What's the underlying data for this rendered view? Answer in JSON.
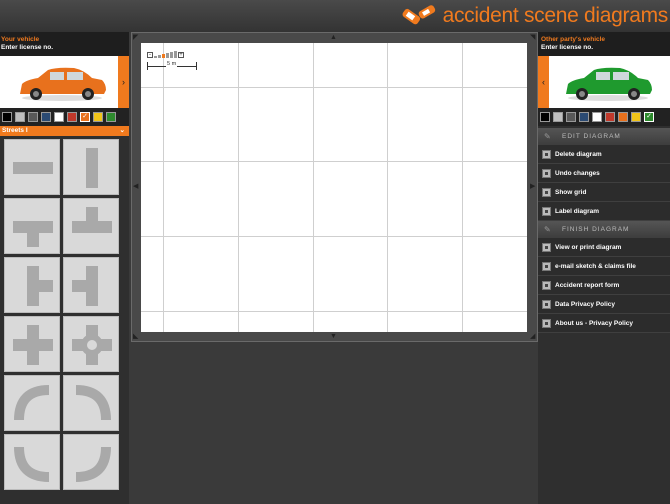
{
  "header": {
    "logo_text": "accident scene diagrams",
    "logo_icon": "crashed-cars-icon"
  },
  "left_panel": {
    "vehicle_title": "Your vehicle",
    "license_prompt": "Enter license no.",
    "vehicle_color": "#e8711d",
    "next_arrow": "›",
    "swatches": [
      "#000000",
      "#bfbfbf",
      "#595959",
      "#2b4a72",
      "#ffffff",
      "#c0392b",
      "#e8711d",
      "#f0c419",
      "#2e8b2e"
    ],
    "selected_swatch_index": 6,
    "streets_label": "Streets I",
    "streets_chevron": "⌄",
    "tiles": [
      "straight-horizontal",
      "straight-vertical",
      "t-junction-down",
      "t-junction-up",
      "t-junction-right",
      "t-junction-left",
      "crossroads",
      "roundabout",
      "curve-top-left",
      "curve-top-right",
      "curve-bottom-left",
      "curve-bottom-right"
    ]
  },
  "canvas": {
    "scale_label": "5 m",
    "zoom_minus": "-",
    "zoom_plus": "+",
    "zoom_level": 2,
    "zoom_levels": 6
  },
  "right_panel": {
    "vehicle_title": "Other party's vehicle",
    "license_prompt": "Enter license no.",
    "vehicle_color": "#1f9a2e",
    "prev_arrow": "‹",
    "swatches": [
      "#000000",
      "#bfbfbf",
      "#595959",
      "#2b4a72",
      "#ffffff",
      "#c0392b",
      "#e8711d",
      "#f0c419",
      "#2e8b2e"
    ],
    "selected_swatch_index": 8,
    "edit_section": "EDIT DIAGRAM",
    "edit_items": [
      "Delete diagram",
      "Undo changes",
      "Show grid",
      "Label diagram"
    ],
    "finish_section": "FINISH DIAGRAM",
    "finish_items": [
      "View or print diagram",
      "e-mail sketch & claims file",
      "Accident report form",
      "Data Privacy Policy",
      "About us - Privacy Policy"
    ]
  }
}
